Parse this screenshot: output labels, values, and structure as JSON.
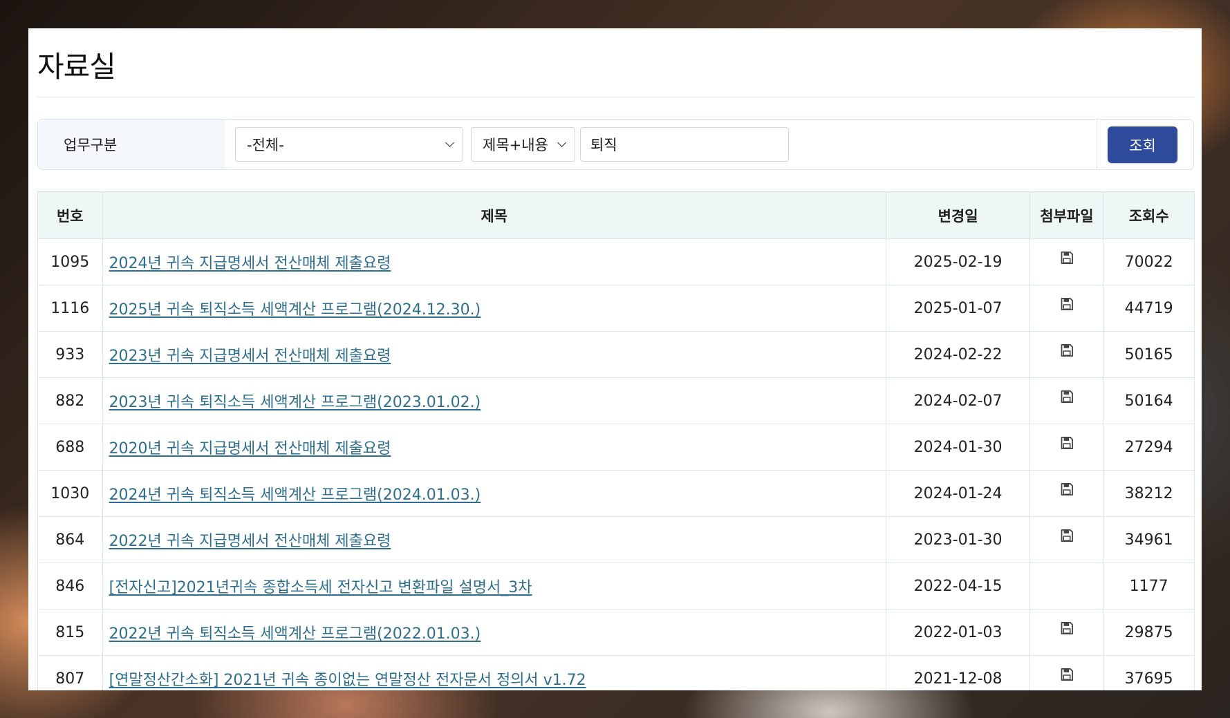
{
  "page": {
    "title": "자료실"
  },
  "search": {
    "label": "업무구분",
    "category_value": "-전체-",
    "field_value": "제목+내용",
    "keyword_value": "퇴직",
    "submit_label": "조회"
  },
  "table": {
    "headers": {
      "no": "번호",
      "title": "제목",
      "date": "변경일",
      "attachment": "첨부파일",
      "views": "조회수"
    },
    "rows": [
      {
        "no": "1095",
        "title": "2024년 귀속 지급명세서 전산매체 제출요령",
        "date": "2025-02-19",
        "has_file": true,
        "views": "70022"
      },
      {
        "no": "1116",
        "title": "2025년 귀속 퇴직소득 세액계산 프로그램(2024.12.30.)",
        "date": "2025-01-07",
        "has_file": true,
        "views": "44719"
      },
      {
        "no": "933",
        "title": "2023년 귀속 지급명세서 전산매체 제출요령",
        "date": "2024-02-22",
        "has_file": true,
        "views": "50165"
      },
      {
        "no": "882",
        "title": "2023년 귀속 퇴직소득 세액계산 프로그램(2023.01.02.)",
        "date": "2024-02-07",
        "has_file": true,
        "views": "50164"
      },
      {
        "no": "688",
        "title": "2020년 귀속 지급명세서 전산매체 제출요령",
        "date": "2024-01-30",
        "has_file": true,
        "views": "27294"
      },
      {
        "no": "1030",
        "title": "2024년 귀속 퇴직소득 세액계산 프로그램(2024.01.03.)",
        "date": "2024-01-24",
        "has_file": true,
        "views": "38212"
      },
      {
        "no": "864",
        "title": "2022년 귀속 지급명세서 전산매체 제출요령",
        "date": "2023-01-30",
        "has_file": true,
        "views": "34961"
      },
      {
        "no": "846",
        "title": "[전자신고]2021년귀속 종합소득세 전자신고 변환파일 설명서_3차",
        "date": "2022-04-15",
        "has_file": false,
        "views": "1177"
      },
      {
        "no": "815",
        "title": "2022년 귀속 퇴직소득 세액계산 프로그램(2022.01.03.)",
        "date": "2022-01-03",
        "has_file": true,
        "views": "29875"
      },
      {
        "no": "807",
        "title": "[연말정산간소화] 2021년 귀속 종이없는 연말정산 전자문서 정의서 v1.72",
        "date": "2021-12-08",
        "has_file": true,
        "views": "37695"
      }
    ]
  },
  "icons": {
    "attachment": "floppy-disk-icon",
    "dropdown": "chevron-down-icon"
  },
  "colors": {
    "primary_button": "#2e4a9a",
    "link": "#2d6e8f",
    "header_bg": "#eef7f6"
  }
}
